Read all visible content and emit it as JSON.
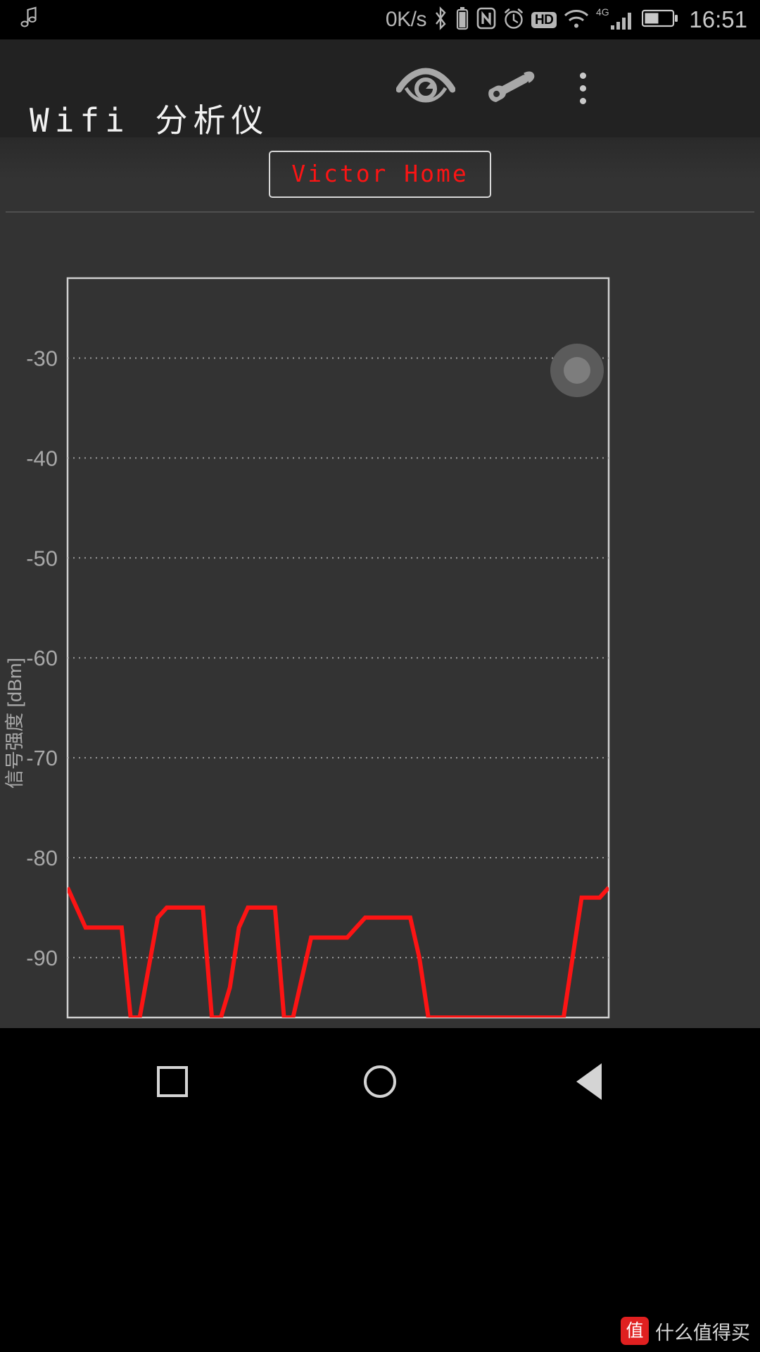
{
  "status_bar": {
    "media_icon": "music-note-icon",
    "network_speed": "0K/s",
    "icons": [
      "bluetooth-icon",
      "bluetooth-battery-icon",
      "nfc-icon",
      "alarm-clock-icon",
      "hd-icon",
      "wifi-icon",
      "4g-icon",
      "signal-bars-icon",
      "battery-icon"
    ],
    "hd_label": "HD",
    "mobile_network_label": "4G",
    "clock": "16:51"
  },
  "app_bar": {
    "title": "Wifi 分析仪",
    "actions": [
      {
        "name": "eye-icon",
        "label": "查看"
      },
      {
        "name": "wrench-icon",
        "label": "工具"
      },
      {
        "name": "overflow-menu-icon",
        "label": "更多"
      }
    ]
  },
  "ssid_selector": {
    "label": "Victor Home",
    "text_color": "#fc1414",
    "border_color": "#d8d8d8"
  },
  "fab": {
    "name": "scan-toggle-button"
  },
  "nav_bar": {
    "buttons": [
      {
        "name": "recents-button",
        "icon": "square-icon"
      },
      {
        "name": "home-button",
        "icon": "circle-icon"
      },
      {
        "name": "back-button",
        "icon": "triangle-left-icon"
      }
    ]
  },
  "watermark": {
    "badge": "值",
    "text": "什么值得买"
  },
  "colors": {
    "accent_red": "#fc1414",
    "chart_bg": "#333333",
    "grid": "#9a9a9a",
    "axis": "#d0d0d0",
    "tick_label": "#a8a8a8"
  },
  "chart_data": {
    "type": "line",
    "title": "",
    "xlabel": "",
    "ylabel": "信号强度 [dBm]",
    "yticks": [
      -30,
      -40,
      -50,
      -60,
      -70,
      -80,
      -90
    ],
    "ytick_labels": [
      "-30",
      "-40",
      "-50",
      "-60",
      "-70",
      "-80",
      "-90"
    ],
    "ylim": [
      -96,
      -22
    ],
    "xlim": [
      0,
      60
    ],
    "grid": true,
    "legend": false,
    "series": [
      {
        "name": "Victor Home",
        "color": "#fc1414",
        "x": [
          0,
          1,
          2,
          3,
          4,
          5,
          6,
          7,
          8,
          9,
          10,
          11,
          12,
          13,
          14,
          15,
          16,
          17,
          18,
          19,
          20,
          21,
          22,
          23,
          24,
          25,
          26,
          27,
          28,
          29,
          30,
          31,
          32,
          33,
          34,
          35,
          36,
          37,
          38,
          39,
          40,
          41,
          42,
          43,
          44,
          45,
          46,
          47,
          48,
          49,
          50,
          51,
          52,
          53,
          54,
          55,
          56,
          57,
          58,
          59,
          60
        ],
        "y": [
          -83,
          -85,
          -87,
          -87,
          -87,
          -87,
          -87,
          -96,
          -96,
          -91,
          -86,
          -85,
          -85,
          -85,
          -85,
          -85,
          -96,
          -96,
          -93,
          -87,
          -85,
          -85,
          -85,
          -85,
          -96,
          -96,
          -92,
          -88,
          -88,
          -88,
          -88,
          -88,
          -87,
          -86,
          -86,
          -86,
          -86,
          -86,
          -86,
          -90,
          -96,
          -96,
          -96,
          -96,
          -96,
          -96,
          -96,
          -96,
          -96,
          -96,
          -96,
          -96,
          -96,
          -96,
          -96,
          -96,
          -90,
          -84,
          -84,
          -84,
          -83
        ]
      }
    ]
  }
}
